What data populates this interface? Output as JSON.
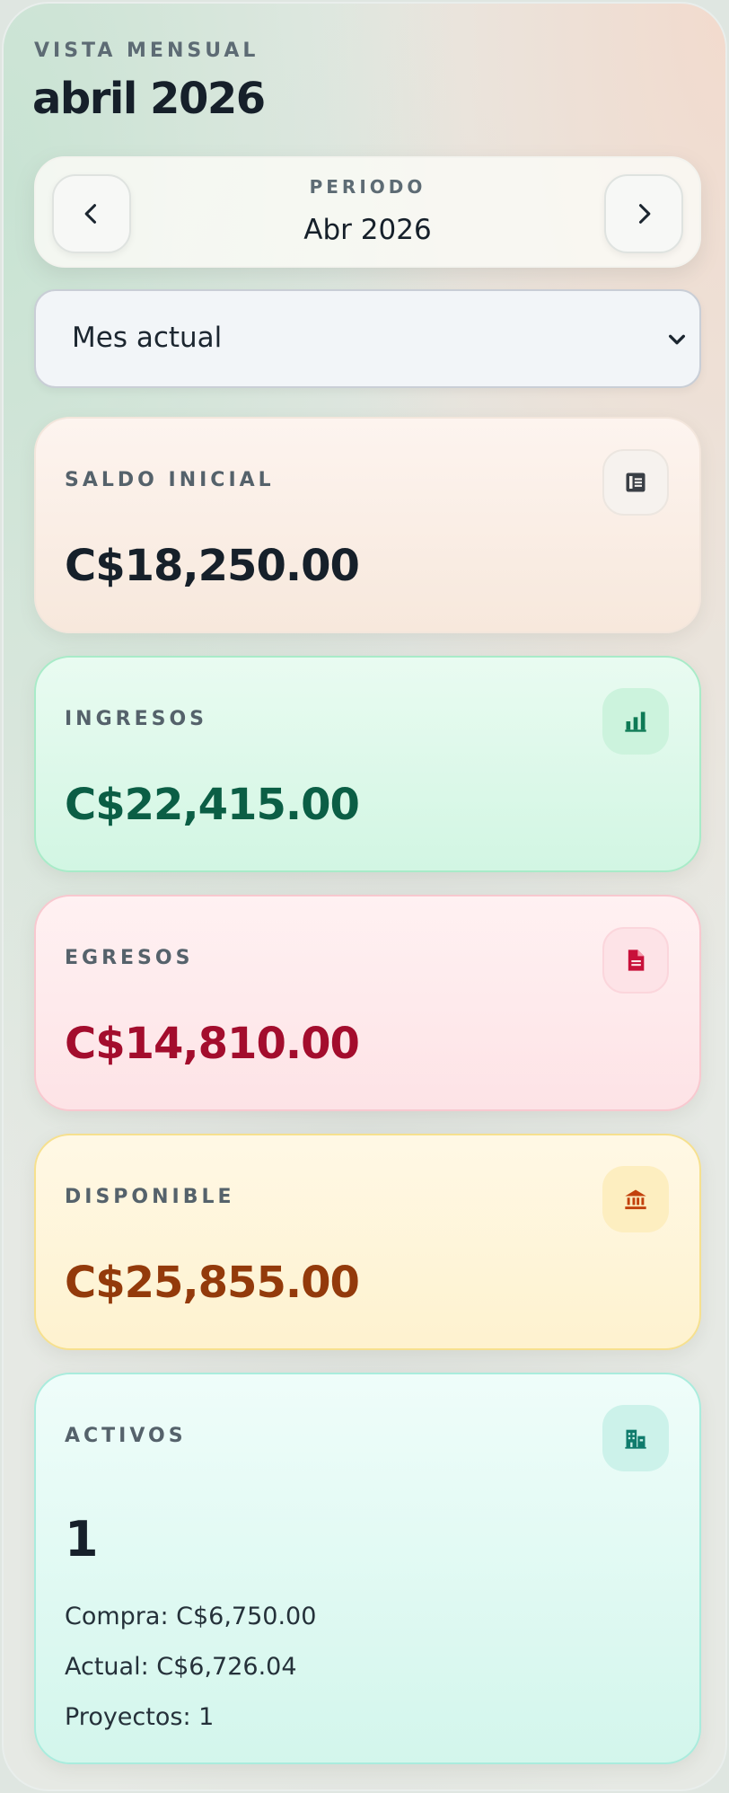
{
  "header": {
    "eyebrow": "VISTA MENSUAL",
    "title": "abril 2026"
  },
  "period": {
    "label": "PERIODO",
    "value": "Abr 2026",
    "prev_icon": "chevron-left-icon",
    "next_icon": "chevron-right-icon"
  },
  "filter": {
    "selected": "Mes actual",
    "icon": "chevron-down-icon"
  },
  "cards": {
    "saldo_inicial": {
      "label": "SALDO INICIAL",
      "value": "C$18,250.00",
      "icon": "ledger-icon",
      "color": "#16202a"
    },
    "ingresos": {
      "label": "INGRESOS",
      "value": "C$22,415.00",
      "icon": "bar-chart-icon",
      "color": "#0b5e45"
    },
    "egresos": {
      "label": "EGRESOS",
      "value": "C$14,810.00",
      "icon": "document-icon",
      "color": "#a30d2d"
    },
    "disponible": {
      "label": "DISPONIBLE",
      "value": "C$25,855.00",
      "icon": "bank-icon",
      "color": "#933a0b"
    },
    "activos": {
      "label": "ACTIVOS",
      "value": "1",
      "icon": "buildings-icon",
      "color": "#16202a",
      "details": [
        "Compra: C$6,750.00",
        "Actual: C$6,726.04",
        "Proyectos: 1"
      ]
    }
  }
}
